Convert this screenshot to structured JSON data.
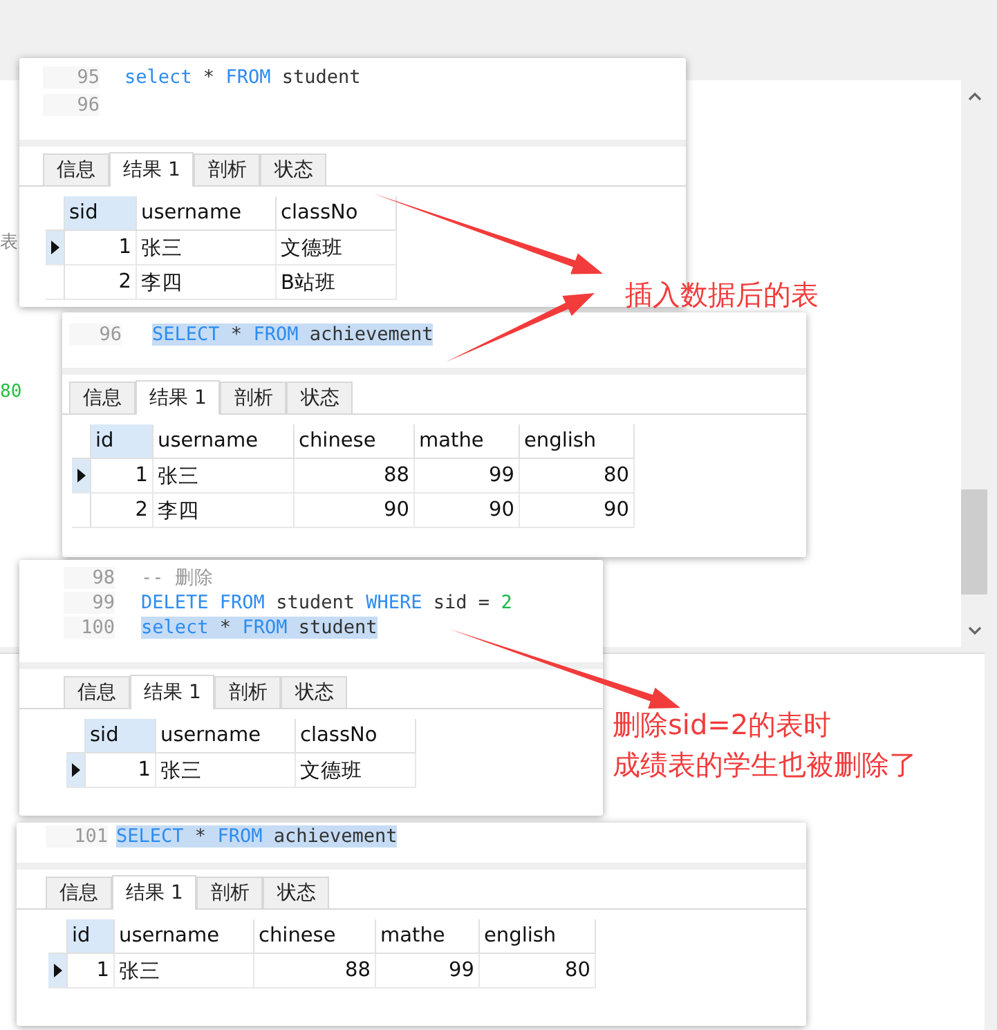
{
  "background_fragments": [
    {
      "text": "表",
      "kind": "plain"
    },
    {
      "text": "80",
      "kind": "number"
    }
  ],
  "panels": [
    {
      "code": [
        {
          "line": "95",
          "tokens": [
            {
              "text": "select",
              "kind": "keyword"
            },
            {
              "text": "*",
              "kind": "plain"
            },
            {
              "text": "FROM",
              "kind": "keyword"
            },
            {
              "text": "student",
              "kind": "plain"
            }
          ]
        },
        {
          "line": "96"
        }
      ],
      "tabs": [
        {
          "label": "信息",
          "selected": false
        },
        {
          "label": "结果 1",
          "selected": true
        },
        {
          "label": "剖析",
          "selected": false
        },
        {
          "label": "状态",
          "selected": false
        }
      ],
      "columns": [
        {
          "label": "sid",
          "kind": "number"
        },
        {
          "label": "username",
          "kind": "text"
        },
        {
          "label": "classNo",
          "kind": "text"
        }
      ],
      "rows": [
        {
          "selected": true,
          "cells": [
            "1",
            "张三",
            "文德班"
          ]
        },
        {
          "selected": false,
          "cells": [
            "2",
            "李四",
            "B站班"
          ]
        }
      ]
    },
    {
      "code": [
        {
          "line": "96",
          "highlighted": true,
          "tokens": [
            {
              "text": "SELECT",
              "kind": "keyword"
            },
            {
              "text": "*",
              "kind": "plain"
            },
            {
              "text": "FROM",
              "kind": "keyword"
            },
            {
              "text": "achievement",
              "kind": "plain"
            }
          ]
        }
      ],
      "tabs": [
        {
          "label": "信息",
          "selected": false
        },
        {
          "label": "结果 1",
          "selected": true
        },
        {
          "label": "剖析",
          "selected": false
        },
        {
          "label": "状态",
          "selected": false
        }
      ],
      "columns": [
        {
          "label": "id",
          "kind": "number"
        },
        {
          "label": "username",
          "kind": "text"
        },
        {
          "label": "chinese",
          "kind": "number"
        },
        {
          "label": "mathe",
          "kind": "number"
        },
        {
          "label": "english",
          "kind": "number"
        }
      ],
      "rows": [
        {
          "selected": true,
          "cells": [
            "1",
            "张三",
            "88",
            "99",
            "80"
          ]
        },
        {
          "selected": false,
          "cells": [
            "2",
            "李四",
            "90",
            "90",
            "90"
          ]
        }
      ]
    },
    {
      "code": [
        {
          "line": "98",
          "tokens": [
            {
              "text": "-- 删除",
              "kind": "comment"
            }
          ]
        },
        {
          "line": "99",
          "tokens": [
            {
              "text": "DELETE",
              "kind": "keyword"
            },
            {
              "text": "FROM",
              "kind": "keyword"
            },
            {
              "text": "student",
              "kind": "plain"
            },
            {
              "text": "WHERE",
              "kind": "keyword"
            },
            {
              "text": "sid =",
              "kind": "plain"
            },
            {
              "text": "2",
              "kind": "number"
            }
          ]
        },
        {
          "line": "100",
          "highlighted": true,
          "tokens": [
            {
              "text": "select",
              "kind": "keyword"
            },
            {
              "text": "*",
              "kind": "plain"
            },
            {
              "text": "FROM",
              "kind": "keyword"
            },
            {
              "text": "student",
              "kind": "plain"
            }
          ]
        }
      ],
      "tabs": [
        {
          "label": "信息",
          "selected": false
        },
        {
          "label": "结果 1",
          "selected": true
        },
        {
          "label": "剖析",
          "selected": false
        },
        {
          "label": "状态",
          "selected": false
        }
      ],
      "columns": [
        {
          "label": "sid",
          "kind": "number"
        },
        {
          "label": "username",
          "kind": "text"
        },
        {
          "label": "classNo",
          "kind": "text"
        }
      ],
      "rows": [
        {
          "selected": true,
          "cells": [
            "1",
            "张三",
            "文德班"
          ]
        }
      ]
    },
    {
      "code": [
        {
          "line": "101",
          "highlighted": true,
          "tokens": [
            {
              "text": "SELECT",
              "kind": "keyword"
            },
            {
              "text": "*",
              "kind": "plain"
            },
            {
              "text": "FROM",
              "kind": "keyword"
            },
            {
              "text": "achievement",
              "kind": "plain"
            }
          ]
        }
      ],
      "tabs": [
        {
          "label": "信息",
          "selected": false
        },
        {
          "label": "结果 1",
          "selected": true
        },
        {
          "label": "剖析",
          "selected": false
        },
        {
          "label": "状态",
          "selected": false
        }
      ],
      "columns": [
        {
          "label": "id",
          "kind": "number"
        },
        {
          "label": "username",
          "kind": "text"
        },
        {
          "label": "chinese",
          "kind": "number"
        },
        {
          "label": "mathe",
          "kind": "number"
        },
        {
          "label": "english",
          "kind": "number"
        }
      ],
      "rows": [
        {
          "selected": true,
          "cells": [
            "1",
            "张三",
            "88",
            "99",
            "80"
          ]
        }
      ]
    }
  ],
  "annotations": [
    "插入数据后的表",
    "删除sid=2的表时",
    "成绩表的学生也被删除了"
  ]
}
